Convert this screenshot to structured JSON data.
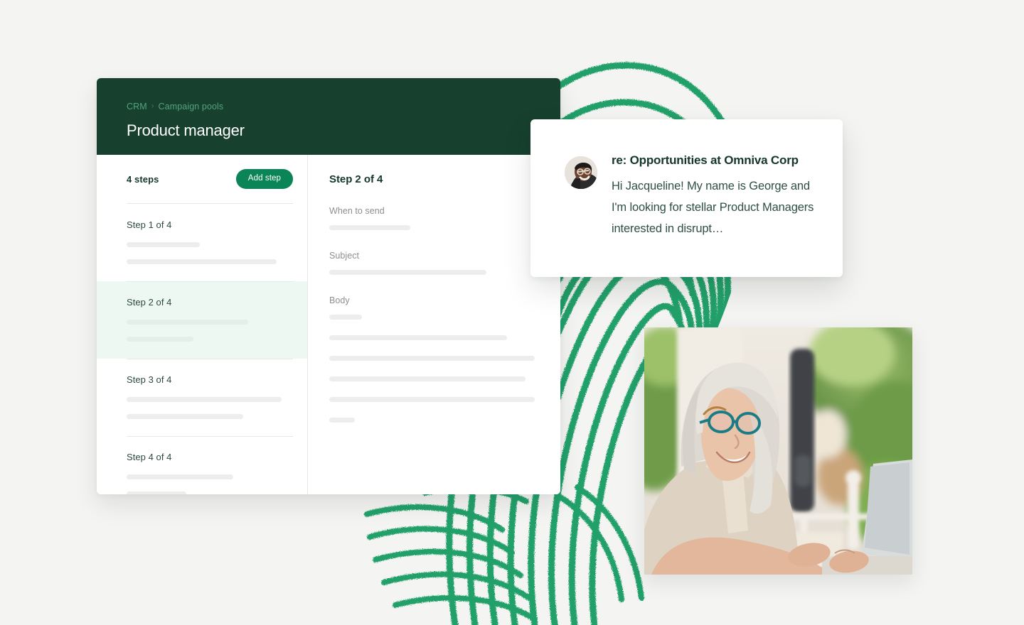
{
  "card": {
    "breadcrumb": {
      "root": "CRM",
      "separator": "›",
      "current": "Campaign pools"
    },
    "title": "Product manager",
    "steps_pane": {
      "count_label": "4 steps",
      "add_step_label": "Add step",
      "steps": [
        {
          "label": "Step 1 of 4",
          "selected": false,
          "skeleton_widths": [
            44,
            90
          ]
        },
        {
          "label": "Step 2 of 4",
          "selected": true,
          "skeleton_widths": [
            73,
            40
          ]
        },
        {
          "label": "Step 3 of 4",
          "selected": false,
          "skeleton_widths": [
            93,
            70
          ]
        },
        {
          "label": "Step 4 of 4",
          "selected": false,
          "skeleton_widths": [
            64,
            36
          ]
        }
      ]
    },
    "detail_pane": {
      "title": "Step 2 of 4",
      "fields": [
        {
          "label": "When to send",
          "skeleton_widths": [
            35
          ]
        },
        {
          "label": "Subject",
          "skeleton_widths": [
            68
          ]
        },
        {
          "label": "Body",
          "skeleton_widths": [
            14
          ]
        }
      ],
      "body_skeleton_widths": [
        77,
        89,
        85,
        89,
        11
      ]
    }
  },
  "email_preview": {
    "avatar_name": "avatar-photo-george",
    "subject": "re: Opportunities at Omniva Corp",
    "snippet": "Hi Jacqueline! My name is George and I'm looking for stellar Product Managers interested in disrupt…"
  },
  "photo": {
    "alt": "woman-at-laptop-photo"
  },
  "colors": {
    "page_background": "#f4f4f2",
    "header_dark_green": "#17402f",
    "accent_green": "#0b8457",
    "breadcrumb_green": "#52a37e",
    "selected_step_mint": "#eef8f3",
    "fingerprint_green": "#23a06b",
    "skeleton_grey": "#ededed"
  }
}
